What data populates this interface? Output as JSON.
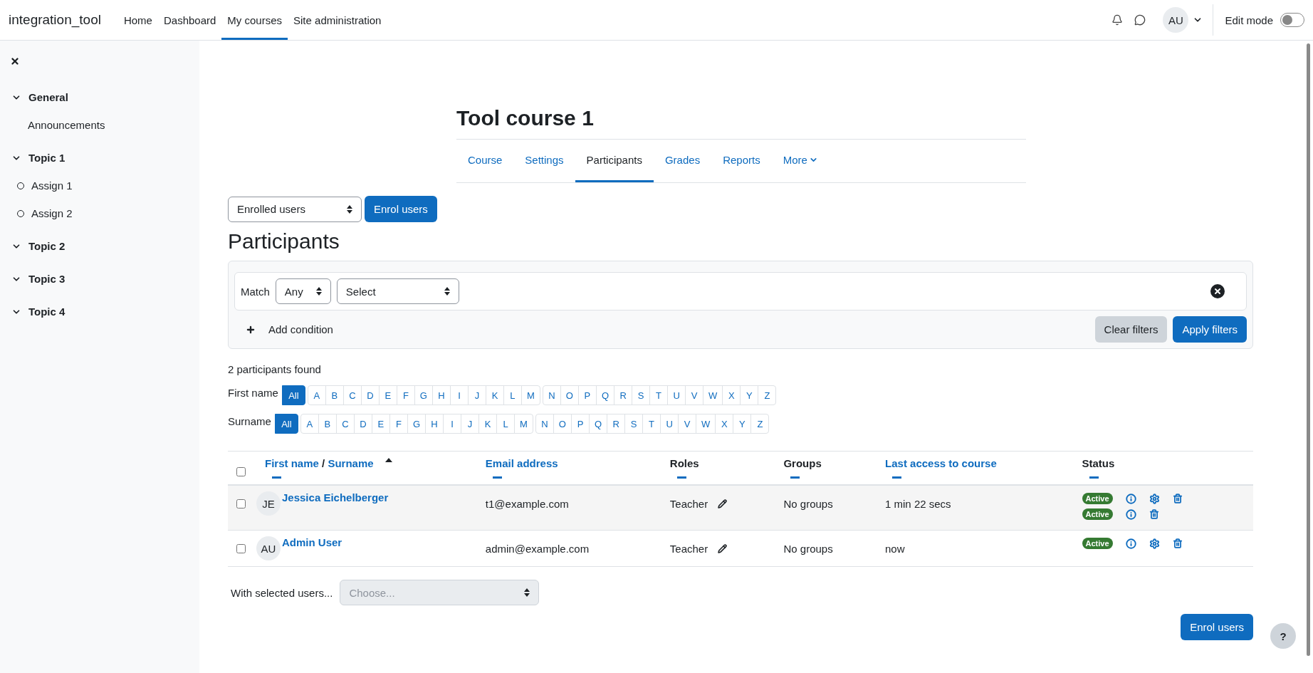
{
  "navbar": {
    "site_name": "integration_tool",
    "items": [
      {
        "label": "Home",
        "selected": false
      },
      {
        "label": "Dashboard",
        "selected": false
      },
      {
        "label": "My courses",
        "selected": true
      },
      {
        "label": "Site administration",
        "selected": false
      }
    ],
    "avatar": "AU",
    "edit_mode": {
      "label": "Edit mode",
      "on": false
    }
  },
  "sidebar": {
    "sections": [
      {
        "title": "General",
        "expanded": true,
        "children": [
          {
            "label": "Announcements",
            "kind": "page"
          }
        ]
      },
      {
        "title": "Topic 1",
        "expanded": true,
        "children": [
          {
            "label": "Assign 1",
            "kind": "activity"
          },
          {
            "label": "Assign 2",
            "kind": "activity"
          }
        ]
      },
      {
        "title": "Topic 2",
        "expanded": true
      },
      {
        "title": "Topic 3",
        "expanded": true
      },
      {
        "title": "Topic 4",
        "expanded": true
      }
    ]
  },
  "course": {
    "title": "Tool course 1",
    "tabs": [
      {
        "label": "Course",
        "selected": false,
        "menu": false
      },
      {
        "label": "Settings",
        "selected": false,
        "menu": false
      },
      {
        "label": "Participants",
        "selected": true,
        "menu": false
      },
      {
        "label": "Grades",
        "selected": false,
        "menu": false
      },
      {
        "label": "Reports",
        "selected": false,
        "menu": false
      },
      {
        "label": "More",
        "selected": false,
        "menu": true
      }
    ]
  },
  "toolbar": {
    "view_select": "Enrolled users",
    "enrol_button": "Enrol users"
  },
  "heading": "Participants",
  "filter": {
    "match_label": "Match",
    "match_value": "Any",
    "condition_value": "Select",
    "add_condition": "Add condition",
    "clear": "Clear filters",
    "apply": "Apply filters"
  },
  "count": "2 participants found",
  "initials_bars": [
    {
      "label": "First name",
      "groups": [
        [
          {
            "label": "All",
            "selected": true
          }
        ],
        [
          {
            "label": "A",
            "selected": false
          },
          {
            "label": "B",
            "selected": false
          },
          {
            "label": "C",
            "selected": false
          },
          {
            "label": "D",
            "selected": false
          },
          {
            "label": "E",
            "selected": false
          },
          {
            "label": "F",
            "selected": false
          },
          {
            "label": "G",
            "selected": false
          },
          {
            "label": "H",
            "selected": false
          },
          {
            "label": "I",
            "selected": false
          },
          {
            "label": "J",
            "selected": false
          },
          {
            "label": "K",
            "selected": false
          },
          {
            "label": "L",
            "selected": false
          },
          {
            "label": "M",
            "selected": false
          }
        ],
        [
          {
            "label": "N",
            "selected": false
          },
          {
            "label": "O",
            "selected": false
          },
          {
            "label": "P",
            "selected": false
          },
          {
            "label": "Q",
            "selected": false
          },
          {
            "label": "R",
            "selected": false
          },
          {
            "label": "S",
            "selected": false
          },
          {
            "label": "T",
            "selected": false
          },
          {
            "label": "U",
            "selected": false
          },
          {
            "label": "V",
            "selected": false
          },
          {
            "label": "W",
            "selected": false
          },
          {
            "label": "X",
            "selected": false
          },
          {
            "label": "Y",
            "selected": false
          },
          {
            "label": "Z",
            "selected": false
          }
        ]
      ]
    },
    {
      "label": "Surname",
      "groups": [
        [
          {
            "label": "All",
            "selected": true
          }
        ],
        [
          {
            "label": "A",
            "selected": false
          },
          {
            "label": "B",
            "selected": false
          },
          {
            "label": "C",
            "selected": false
          },
          {
            "label": "D",
            "selected": false
          },
          {
            "label": "E",
            "selected": false
          },
          {
            "label": "F",
            "selected": false
          },
          {
            "label": "G",
            "selected": false
          },
          {
            "label": "H",
            "selected": false
          },
          {
            "label": "I",
            "selected": false
          },
          {
            "label": "J",
            "selected": false
          },
          {
            "label": "K",
            "selected": false
          },
          {
            "label": "L",
            "selected": false
          },
          {
            "label": "M",
            "selected": false
          }
        ],
        [
          {
            "label": "N",
            "selected": false
          },
          {
            "label": "O",
            "selected": false
          },
          {
            "label": "P",
            "selected": false
          },
          {
            "label": "Q",
            "selected": false
          },
          {
            "label": "R",
            "selected": false
          },
          {
            "label": "S",
            "selected": false
          },
          {
            "label": "T",
            "selected": false
          },
          {
            "label": "U",
            "selected": false
          },
          {
            "label": "V",
            "selected": false
          },
          {
            "label": "W",
            "selected": false
          },
          {
            "label": "X",
            "selected": false
          },
          {
            "label": "Y",
            "selected": false
          },
          {
            "label": "Z",
            "selected": false
          }
        ]
      ]
    }
  ],
  "table": {
    "select_all_checked": false,
    "columns": [
      {
        "parts": [
          {
            "text": "First name",
            "link": true
          },
          {
            "text": "/",
            "link": false
          },
          {
            "text": "Surname",
            "link": true
          }
        ],
        "sorted": true
      },
      {
        "parts": [
          {
            "text": "Email address",
            "link": true
          }
        ],
        "sorted": false
      },
      {
        "parts": [
          {
            "text": "Roles",
            "link": false
          }
        ],
        "sorted": false
      },
      {
        "parts": [
          {
            "text": "Groups",
            "link": false
          }
        ],
        "sorted": false
      },
      {
        "parts": [
          {
            "text": "Last access to course",
            "link": true
          }
        ],
        "sorted": false
      },
      {
        "parts": [
          {
            "text": "Status",
            "link": false
          }
        ],
        "sorted": false
      }
    ],
    "rows": [
      {
        "checked": false,
        "initials": "JE",
        "name": "Jessica Eichelberger",
        "email": "t1@example.com",
        "role": "Teacher",
        "groups": "No groups",
        "last_access": "1 min 22 secs",
        "enrolments": [
          {
            "status": "Active",
            "editable": true
          },
          {
            "status": "Active",
            "editable": false
          }
        ]
      },
      {
        "checked": false,
        "initials": "AU",
        "name": "Admin User",
        "email": "admin@example.com",
        "role": "Teacher",
        "groups": "No groups",
        "last_access": "now",
        "enrolments": [
          {
            "status": "Active",
            "editable": true
          }
        ]
      }
    ]
  },
  "bulk": {
    "label": "With selected users...",
    "placeholder": "Choose...",
    "disabled": true
  },
  "footer_button": "Enrol users",
  "help": "?"
}
